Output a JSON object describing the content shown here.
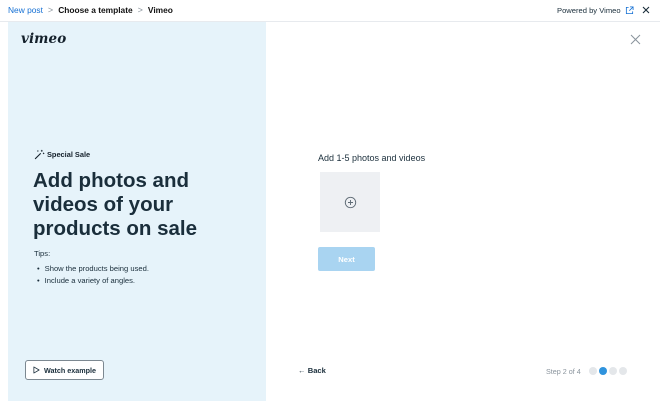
{
  "breadcrumb": {
    "items": [
      "New post",
      "Choose a template",
      "Vimeo"
    ],
    "separator": ">"
  },
  "header": {
    "powered_by": "Powered by Vimeo"
  },
  "left_panel": {
    "logo": "vimeo",
    "tag": "Special Sale",
    "headline": "Add photos and videos of your products on sale",
    "tips_title": "Tips:",
    "tips": [
      "Show the products being used.",
      "Include a variety of angles."
    ],
    "watch_button": "Watch example",
    "background": "#e6f3fa"
  },
  "main": {
    "upload_label": "Add 1-5 photos and videos",
    "next_button": "Next",
    "back_link": "← Back",
    "step_text": "Step 2 of 4",
    "step_current": 2,
    "step_total": 4
  },
  "colors": {
    "link": "#1570d4",
    "accent": "#2f93dd",
    "next_disabled": "#a9d4f1"
  },
  "icons": [
    "external-link-icon",
    "close-icon",
    "magic-wand-icon",
    "play-icon",
    "add-circle-icon"
  ]
}
